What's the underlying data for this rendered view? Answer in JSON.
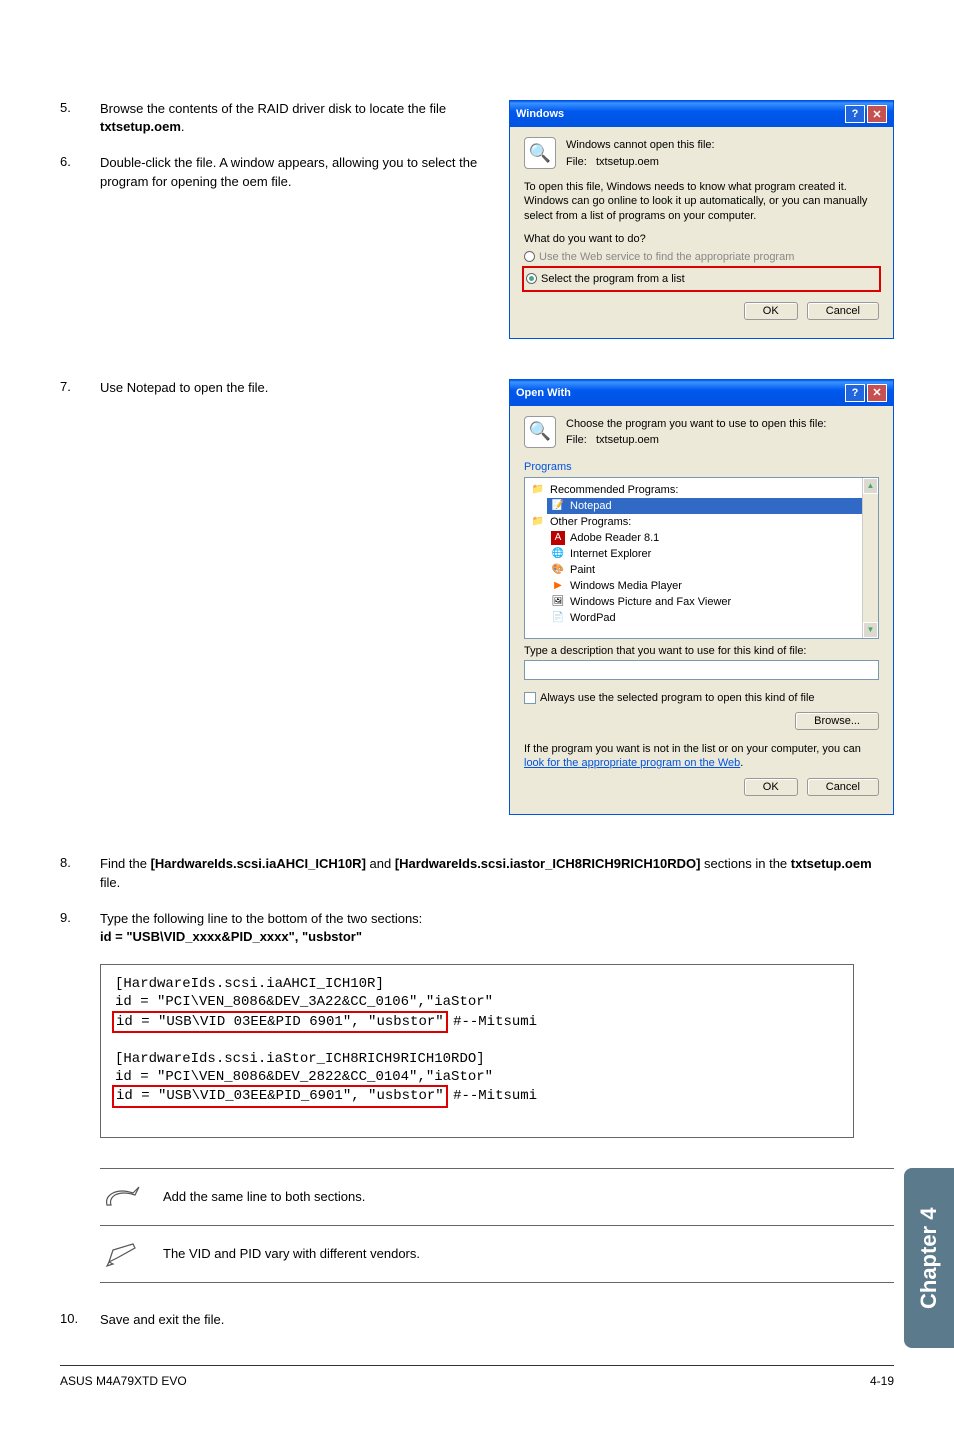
{
  "steps": {
    "s5": {
      "num": "5.",
      "text_a": "Browse the contents of the RAID driver disk to locate the file ",
      "bold": "txtsetup.oem",
      "text_b": "."
    },
    "s6": {
      "num": "6.",
      "text": "Double-click the file. A window appears, allowing you to select the program for opening the oem file."
    },
    "s7": {
      "num": "7.",
      "text": "Use Notepad to open the file."
    },
    "s8": {
      "num": "8.",
      "text_a": "Find the ",
      "bold1": "[HardwareIds.scsi.iaAHCI_ICH10R]",
      "text_b": " and ",
      "bold2": "[HardwareIds.scsi.iastor_ICH8RICH9RICH10RDO]",
      "text_c": " sections in the ",
      "bold3": "txtsetup.oem",
      "text_d": " file."
    },
    "s9": {
      "num": "9.",
      "text": "Type the following line to the bottom of the two sections:",
      "bold": "id = \"USB\\VID_xxxx&PID_xxxx\", \"usbstor\""
    },
    "s10": {
      "num": "10.",
      "text": "Save and exit the file."
    }
  },
  "dialog1": {
    "title": "Windows",
    "msg": "Windows cannot open this file:",
    "file_label": "File:",
    "file_name": "txtsetup.oem",
    "desc": "To open this file, Windows needs to know what program created it.  Windows can go online to look it up automatically, or you can manually select from a list of programs on your computer.",
    "question": "What do you want to do?",
    "opt1": "Use the Web service to find the appropriate program",
    "opt2": "Select the program from a list",
    "ok": "OK",
    "cancel": "Cancel"
  },
  "dialog2": {
    "title": "Open With",
    "msg": "Choose the program you want to use to open this file:",
    "file_label": "File:",
    "file_name": "txtsetup.oem",
    "programs_label": "Programs",
    "rec": "Recommended Programs:",
    "notepad": "Notepad",
    "other": "Other Programs:",
    "progs": [
      "Adobe Reader 8.1",
      "Internet Explorer",
      "Paint",
      "Windows Media Player",
      "Windows Picture and Fax Viewer",
      "WordPad"
    ],
    "desc_label": "Type a description that you want to use for this kind of file:",
    "always": "Always use the selected program to open this kind of file",
    "browse": "Browse...",
    "footer_a": "If the program you want is not in the list or on your computer, you can ",
    "footer_link": "look for the appropriate program on the Web",
    "footer_b": ".",
    "ok": "OK",
    "cancel": "Cancel"
  },
  "code": {
    "l1": "[HardwareIds.scsi.iaAHCI_ICH10R]",
    "l2": "id = \"PCI\\VEN_8086&DEV_3A22&CC_0106\",\"iaStor\"",
    "l3a": "id = \"USB\\VID 03EE&PID 6901\", \"usbstor\"",
    "l3b": "#--Mitsumi",
    "l4": "[HardwareIds.scsi.iaStor_ICH8RICH9RICH10RDO]",
    "l5": "id = \"PCI\\VEN_8086&DEV_2822&CC_0104\",\"iaStor\"",
    "l6a": "id = \"USB\\VID_03EE&PID_6901\", \"usbstor\"",
    "l6b": "#--Mitsumi"
  },
  "notes": {
    "n1": "Add the same line to both sections.",
    "n2": "The VID and PID vary with different vendors."
  },
  "chapter": "Chapter 4",
  "footer": {
    "left": "ASUS M4A79XTD EVO",
    "right": "4-19"
  }
}
